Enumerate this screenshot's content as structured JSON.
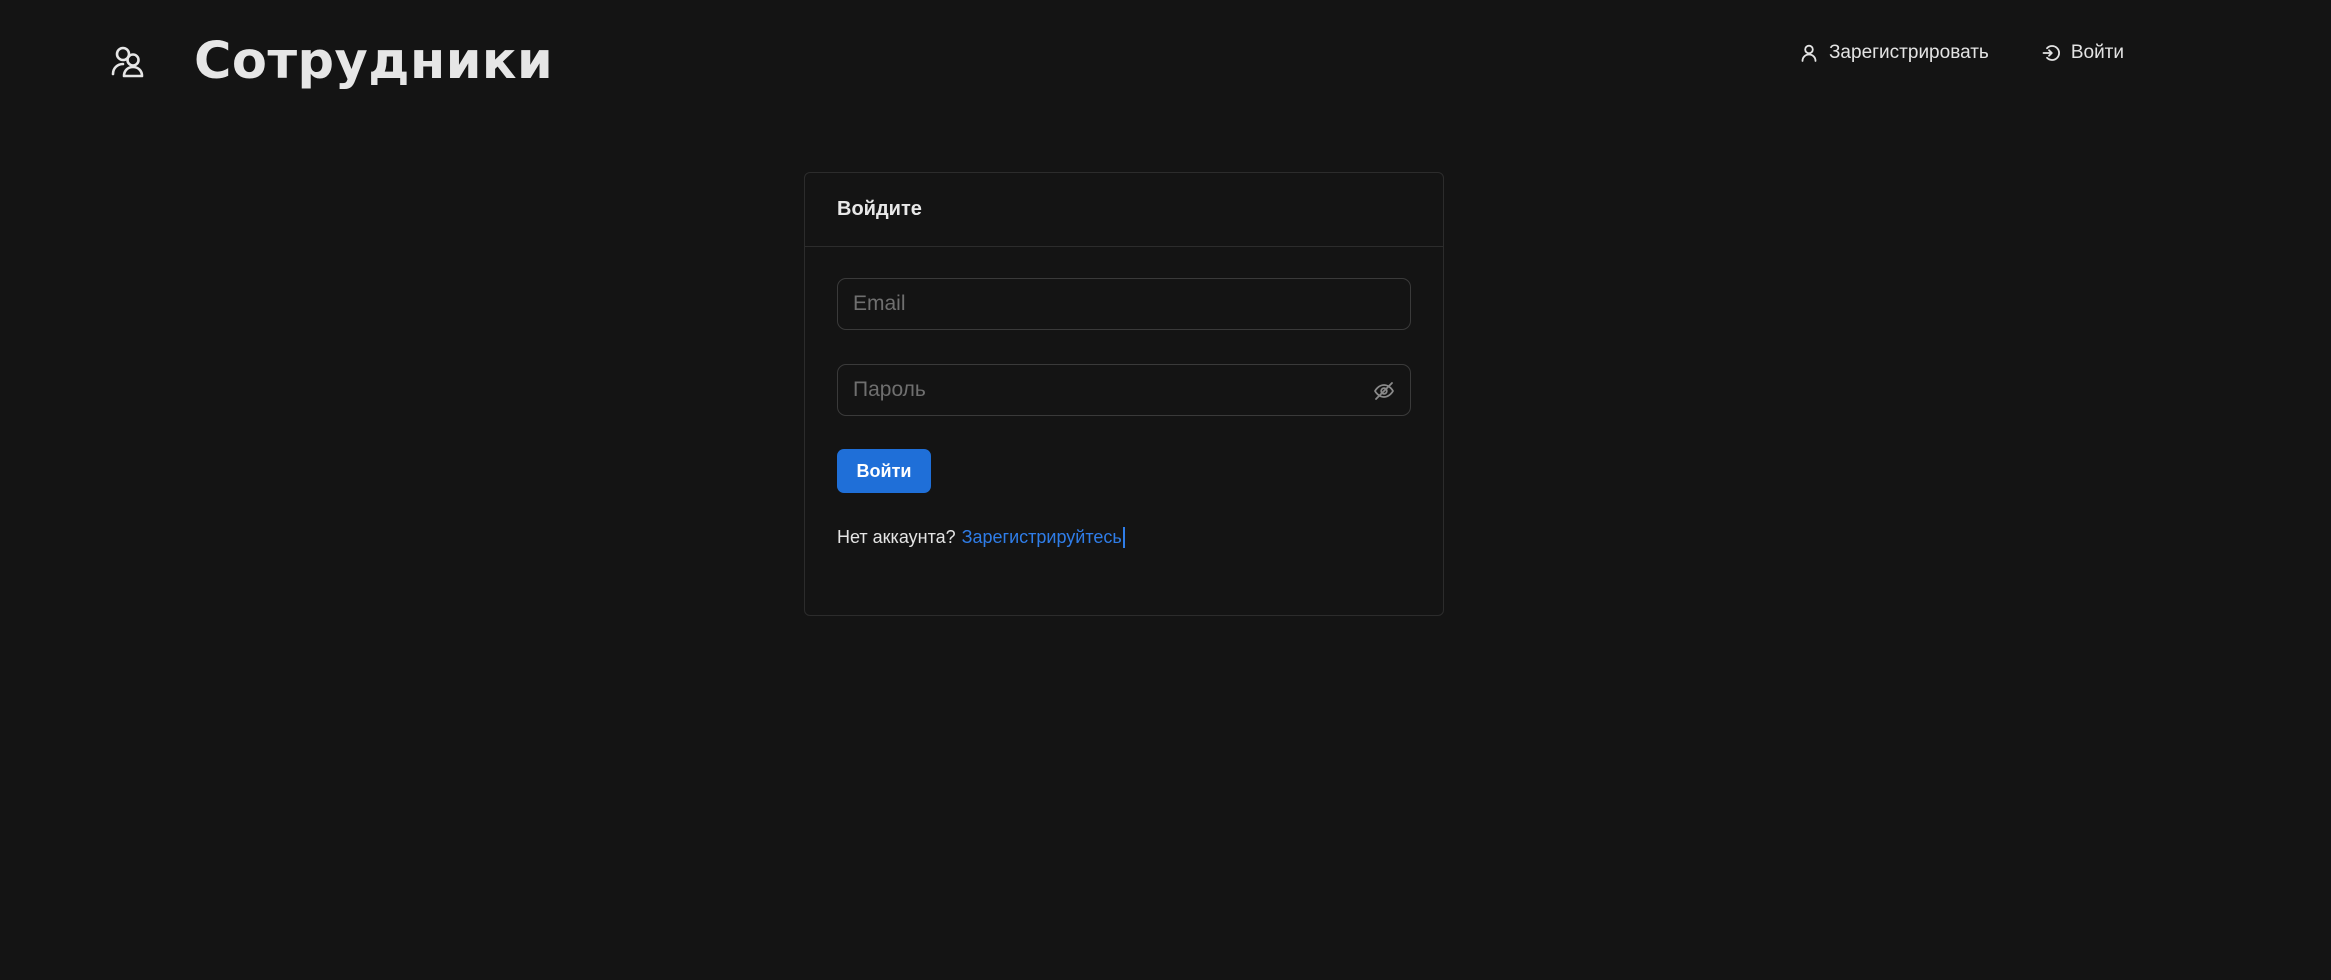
{
  "header": {
    "brand_icon": "users-icon",
    "title": "Сотрудники",
    "nav": {
      "register": {
        "label": "Зарегистрировать",
        "icon": "user-icon"
      },
      "login": {
        "label": "Войти",
        "icon": "login-icon"
      }
    }
  },
  "login_card": {
    "title": "Войдите",
    "email": {
      "placeholder": "Email",
      "value": ""
    },
    "password": {
      "placeholder": "Пароль",
      "value": "",
      "toggle_icon": "eye-off-icon"
    },
    "submit_label": "Войти",
    "no_account_text": "Нет аккаунта?",
    "register_link": "Зарегистрируйтесь"
  },
  "colors": {
    "background": "#141414",
    "accent": "#1f6fd8",
    "link": "#2f7de8",
    "border": "#2c2c2c"
  }
}
